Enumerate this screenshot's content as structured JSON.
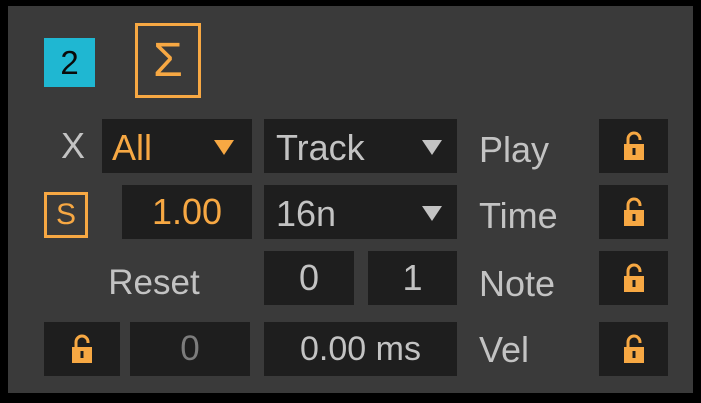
{
  "badge": {
    "number": "2"
  },
  "sigma": {
    "symbol": "Σ"
  },
  "row1": {
    "x_label": "X",
    "pitch_select": "All",
    "mode_select": "Track",
    "play_label": "Play"
  },
  "row2": {
    "s_label": "S",
    "rate_value": "1.00",
    "division_select": "16n",
    "time_label": "Time"
  },
  "row3": {
    "reset_label": "Reset",
    "range_low": "0",
    "range_high": "1",
    "note_label": "Note"
  },
  "row4": {
    "offset_value": "0",
    "delay_value": "0.00 ms",
    "vel_label": "Vel"
  },
  "colors": {
    "accent": "#f7a843",
    "badge": "#1fb7d2",
    "panel": "#3a3a3a",
    "field": "#1e1e1e",
    "text": "#c3c3c3"
  },
  "icons": [
    "lock-open-icon",
    "dropdown-arrow-icon",
    "sigma-icon"
  ]
}
